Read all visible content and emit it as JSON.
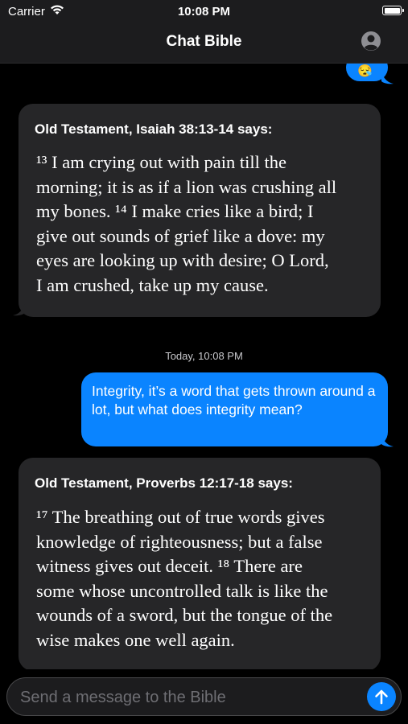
{
  "status_bar": {
    "carrier": "Carrier",
    "time": "10:08 PM",
    "battery_level": 1.0
  },
  "nav": {
    "title": "Chat Bible",
    "profile_icon": "person-circle-icon"
  },
  "messages": [
    {
      "type": "outgoing",
      "text": "😪"
    },
    {
      "type": "incoming",
      "title": "Old Testament, Isaiah 38:13-14 says:",
      "text": "¹³ I am crying out with pain till the\nmorning; it is as if a lion was crushing all\nmy bones. ¹⁴ I make cries like a bird; I\ngive out sounds of grief like a dove: my\neyes are looking up with desire; O Lord,\nI am crushed, take up my cause."
    },
    {
      "type": "timestamp",
      "text": "Today, 10:08 PM"
    },
    {
      "type": "outgoing",
      "text": "Integrity, it’s a word that gets thrown around a lot, but what does integrity mean?"
    },
    {
      "type": "incoming",
      "title": "Old Testament, Proverbs 12:17-18 says:",
      "text": "¹⁷ The breathing out of true words gives\nknowledge of righteousness; but a false\nwitness gives out deceit. ¹⁸ There are\nsome whose uncontrolled talk is like the\nwounds of a sword, but the tongue of the\nwise makes one well again."
    }
  ],
  "input": {
    "placeholder": "Send a message to the Bible",
    "value": ""
  },
  "colors": {
    "accent": "#0a84ff",
    "incoming_bubble": "#262628",
    "bar_background": "#1c1c1e"
  }
}
